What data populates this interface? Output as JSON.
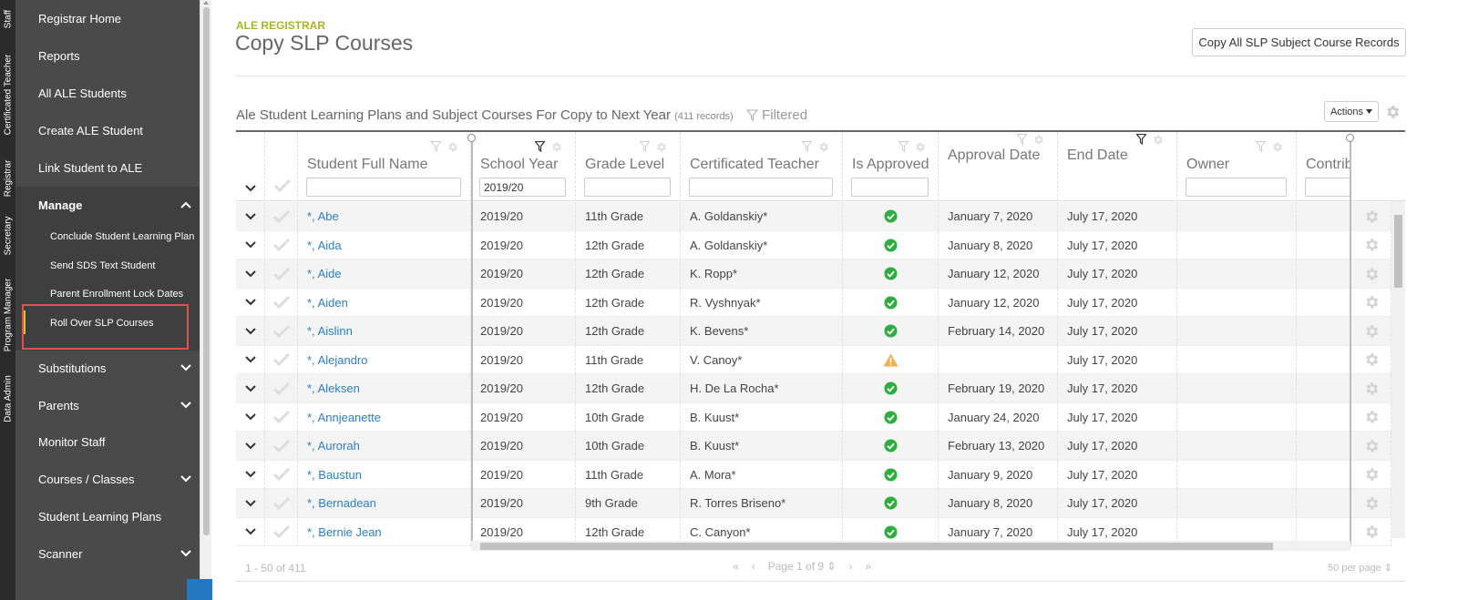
{
  "role_tabs": [
    "Staff",
    "Certificated Teacher",
    "Registrar",
    "Secretary",
    "Program Manager",
    "Data Admin"
  ],
  "sidebar": {
    "top_items": [
      "Registrar Home",
      "Reports",
      "All ALE Students",
      "Create ALE Student",
      "Link Student to ALE"
    ],
    "manage_label": "Manage",
    "manage_items": [
      "Conclude Student Learning Plan",
      "Send SDS Text Student",
      "Parent Enrollment Lock Dates",
      "Roll Over SLP Courses"
    ],
    "bottom_items": [
      {
        "label": "Substitutions",
        "has_chevron": true
      },
      {
        "label": "Parents",
        "has_chevron": true
      },
      {
        "label": "Monitor Staff",
        "has_chevron": false
      },
      {
        "label": "Courses / Classes",
        "has_chevron": true
      },
      {
        "label": "Student Learning Plans",
        "has_chevron": false
      },
      {
        "label": "Scanner",
        "has_chevron": true
      }
    ]
  },
  "header": {
    "kicker": "ALE REGISTRAR",
    "title": "Copy SLP Courses",
    "copy_all_button": "Copy All SLP Subject Course Records"
  },
  "grid": {
    "title": "Ale Student Learning Plans and Subject Courses For Copy to Next Year",
    "record_count": "(411 records)",
    "filtered_label": "Filtered",
    "actions_label": "Actions",
    "columns": [
      "Student Full Name",
      "School Year",
      "Grade Level",
      "Certificated Teacher",
      "Is Approved",
      "Approval Date",
      "End Date",
      "Owner",
      "Contrib"
    ],
    "school_year_filter": "2019/20",
    "rows": [
      {
        "name": "*, Abe",
        "year": "2019/20",
        "grade": "11th Grade",
        "teacher": "A. Goldanskiy*",
        "approved": "ok",
        "approval_date": "January 7, 2020",
        "end_date": "July 17, 2020"
      },
      {
        "name": "*, Aida",
        "year": "2019/20",
        "grade": "12th Grade",
        "teacher": "A. Goldanskiy*",
        "approved": "ok",
        "approval_date": "January 8, 2020",
        "end_date": "July 17, 2020"
      },
      {
        "name": "*, Aide",
        "year": "2019/20",
        "grade": "12th Grade",
        "teacher": "K. Ropp*",
        "approved": "ok",
        "approval_date": "January 12, 2020",
        "end_date": "July 17, 2020"
      },
      {
        "name": "*, Aiden",
        "year": "2019/20",
        "grade": "12th Grade",
        "teacher": "R. Vyshnyak*",
        "approved": "ok",
        "approval_date": "January 12, 2020",
        "end_date": "July 17, 2020"
      },
      {
        "name": "*, Aislinn",
        "year": "2019/20",
        "grade": "12th Grade",
        "teacher": "K. Bevens*",
        "approved": "ok",
        "approval_date": "February 14, 2020",
        "end_date": "July 17, 2020"
      },
      {
        "name": "*, Alejandro",
        "year": "2019/20",
        "grade": "11th Grade",
        "teacher": "V. Canoy*",
        "approved": "warn",
        "approval_date": "",
        "end_date": "July 17, 2020"
      },
      {
        "name": "*, Aleksen",
        "year": "2019/20",
        "grade": "12th Grade",
        "teacher": "H. De La Rocha*",
        "approved": "ok",
        "approval_date": "February 19, 2020",
        "end_date": "July 17, 2020"
      },
      {
        "name": "*, Annjeanette",
        "year": "2019/20",
        "grade": "10th Grade",
        "teacher": "B. Kuust*",
        "approved": "ok",
        "approval_date": "January 24, 2020",
        "end_date": "July 17, 2020"
      },
      {
        "name": "*, Aurorah",
        "year": "2019/20",
        "grade": "10th Grade",
        "teacher": "B. Kuust*",
        "approved": "ok",
        "approval_date": "February 13, 2020",
        "end_date": "July 17, 2020"
      },
      {
        "name": "*, Baustun",
        "year": "2019/20",
        "grade": "11th Grade",
        "teacher": "A. Mora*",
        "approved": "ok",
        "approval_date": "January 9, 2020",
        "end_date": "July 17, 2020"
      },
      {
        "name": "*, Bernadean",
        "year": "2019/20",
        "grade": "9th Grade",
        "teacher": "R. Torres Briseno*",
        "approved": "ok",
        "approval_date": "January 8, 2020",
        "end_date": "July 17, 2020"
      },
      {
        "name": "*, Bernie Jean",
        "year": "2019/20",
        "grade": "12th Grade",
        "teacher": "C. Canyon*",
        "approved": "ok",
        "approval_date": "January 7, 2020",
        "end_date": "July 17, 2020"
      }
    ]
  },
  "pager": {
    "range": "1 - 50 of 411",
    "page_label": "Page 1 of 9",
    "per_page": "50 per page"
  },
  "colors": {
    "accent": "#a8b42a",
    "link": "#2a7fc8",
    "approved": "#2eae3f",
    "warning": "#f0ad4e",
    "highlight_border": "#d9534f"
  },
  "icons": {
    "chevron": "chevron-down-icon",
    "check": "checkmark-icon",
    "gear": "gear-icon",
    "filter": "filter-icon",
    "approved": "check-circle-icon",
    "warning": "warning-triangle-icon"
  }
}
